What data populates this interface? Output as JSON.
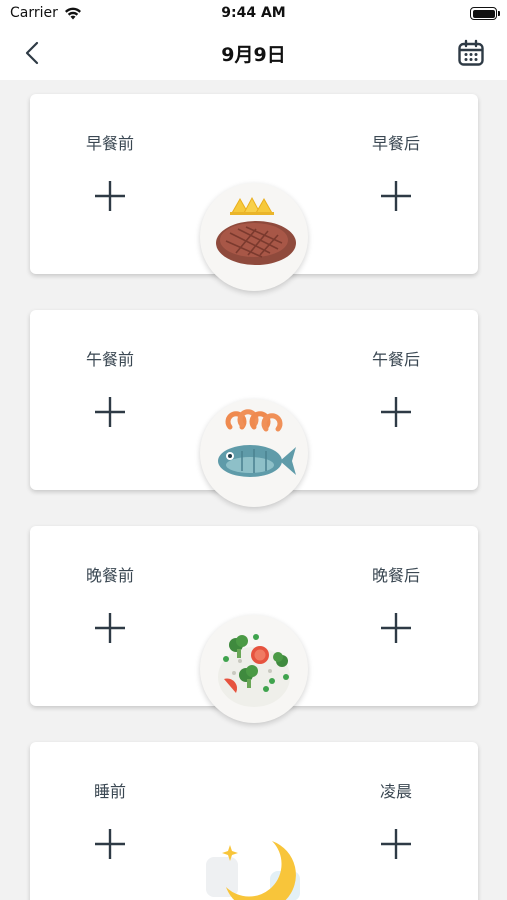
{
  "status_bar": {
    "carrier": "Carrier",
    "time": "9:44 AM"
  },
  "nav": {
    "title": "9月9日",
    "back_icon": "chevron-left-icon",
    "calendar_icon": "calendar-icon"
  },
  "meals": [
    {
      "before_label": "早餐前",
      "after_label": "早餐后",
      "image": "steak"
    },
    {
      "before_label": "午餐前",
      "after_label": "午餐后",
      "image": "fish-and-shrimp"
    },
    {
      "before_label": "晚餐前",
      "after_label": "晚餐后",
      "image": "vegetable-salad"
    },
    {
      "before_label": "睡前",
      "after_label": "凌晨",
      "image": "moon"
    }
  ],
  "colors": {
    "background": "#f2f2f2",
    "card": "#ffffff",
    "icon": "#2e3a45"
  }
}
